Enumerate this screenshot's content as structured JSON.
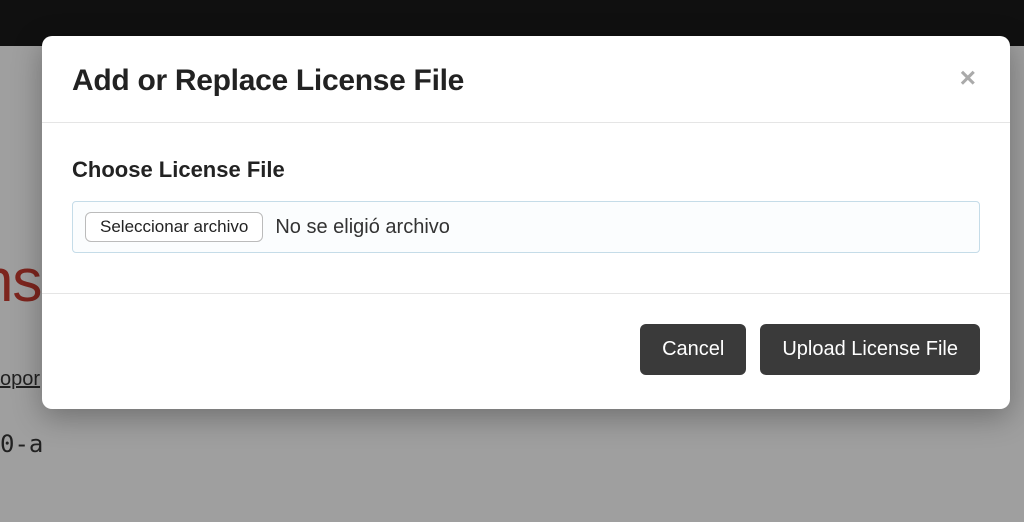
{
  "background": {
    "partial_heading": "ns",
    "partial_link": "opor",
    "partial_mono": "0-a"
  },
  "modal": {
    "title": "Add or Replace License File",
    "close_glyph": "×",
    "field_label": "Choose License File",
    "file_picker_label": "Seleccionar archivo",
    "file_status": "No se eligió archivo",
    "cancel_label": "Cancel",
    "upload_label": "Upload License File"
  }
}
